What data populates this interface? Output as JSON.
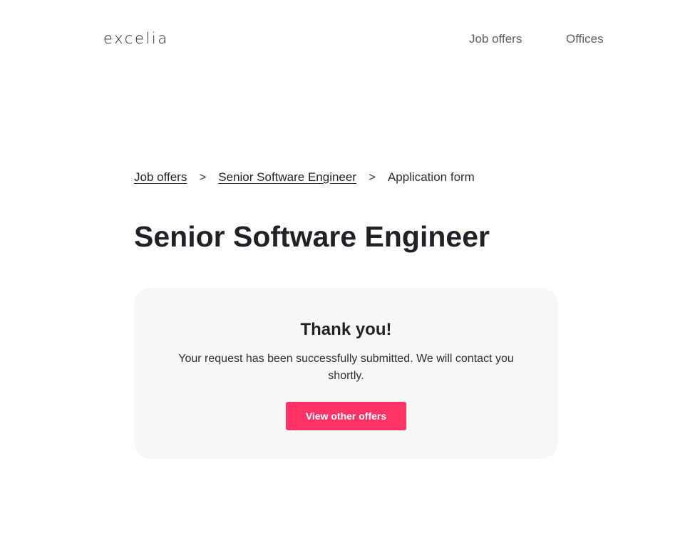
{
  "header": {
    "logo": "excelia",
    "nav": [
      {
        "label": "Job offers"
      },
      {
        "label": "Offices"
      }
    ]
  },
  "breadcrumb": {
    "items": [
      "Job offers",
      "Senior Software Engineer",
      "Application form"
    ],
    "separator": ">"
  },
  "page": {
    "title": "Senior Software Engineer"
  },
  "confirmation": {
    "heading": "Thank you!",
    "message": "Your request has been successfully submitted. We will contact you shortly.",
    "button_label": "View other offers"
  },
  "colors": {
    "accent": "#ff3366",
    "card_background": "#f7f7f7",
    "text": "#1f2328",
    "nav_text": "#5b6066"
  }
}
